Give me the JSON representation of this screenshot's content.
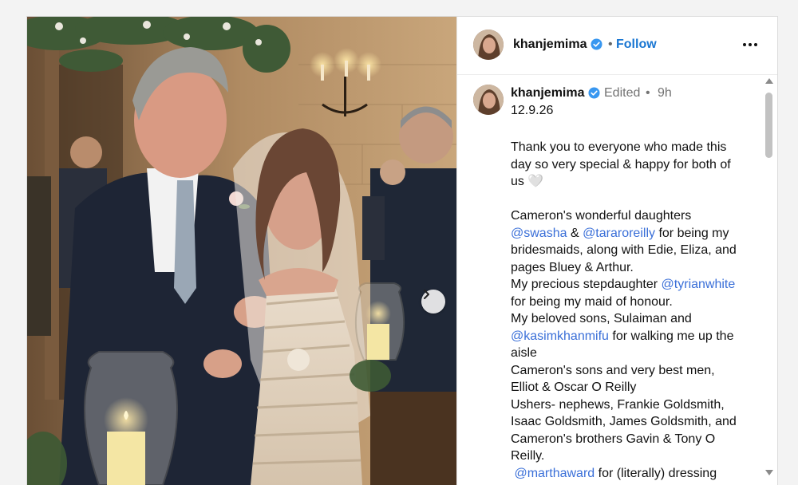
{
  "post": {
    "username": "khanjemima",
    "follow_label": "Follow",
    "separator": "•",
    "edited_label": "Edited",
    "time_ago": "9h",
    "date_line": "12.9.26"
  },
  "caption": {
    "p1": [
      "Thank you to everyone who made this",
      "day so very special & happy for both of",
      "us 🤍"
    ],
    "l1a": "Cameron's wonderful daughters",
    "m1": "@swasha",
    "l2a": " & ",
    "m2": "@tararoreilly",
    "l2b": " for being my",
    "l3": "bridesmaids, along with Edie, Eliza, and",
    "l4": "pages Bluey & Arthur.",
    "l5a": "My precious stepdaughter ",
    "m3": "@tyrianwhite",
    "l6": "for being my maid of honour.",
    "l7": "My beloved sons, Sulaiman and",
    "m4": "@kasimkhanmifu",
    "l8b": " for walking me up the",
    "l9": "aisle",
    "l10": "Cameron's sons and very best men,",
    "l11": "Elliot & Oscar O Reilly",
    "l12": "Ushers- nephews, Frankie Goldsmith,",
    "l13": "Isaac Goldsmith, James Goldsmith, and",
    "l14": "Cameron's brothers Gavin & Tony O",
    "l15": "Reilly.",
    "m5": "@marthaward",
    "l16b": " for (literally) dressing"
  },
  "colors": {
    "link": "#3a6fd8",
    "follow": "#1976d2",
    "verified": "#3897f0"
  },
  "icons": {
    "verified": "verified-badge-icon",
    "more": "more-options-icon",
    "next": "chevron-right-icon"
  }
}
